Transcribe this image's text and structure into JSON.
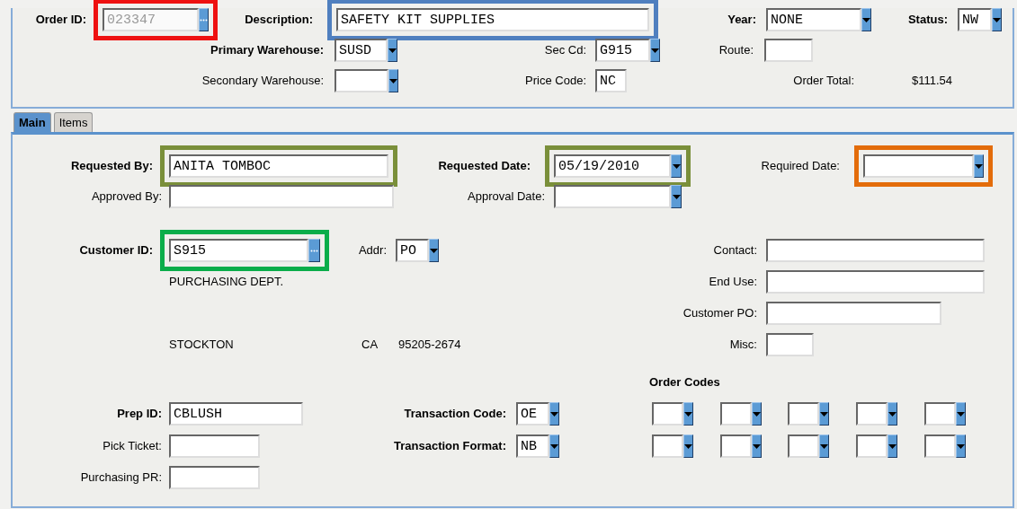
{
  "header": {
    "rows": [
      {
        "fields": [
          {
            "label": "Order ID:",
            "bold": true,
            "control": {
              "kind": "lookup",
              "value": "023347",
              "disabled": true,
              "color": "#ee1111"
            }
          },
          {
            "label": "Description:",
            "bold": true,
            "control": {
              "kind": "input",
              "value": "SAFETY KIT SUPPLIES",
              "color": "#4f7fbf"
            }
          },
          {
            "label": "Year:",
            "bold": true,
            "control": {
              "kind": "select",
              "value": "NONE"
            }
          },
          {
            "label": "Status:",
            "bold": true,
            "control": {
              "kind": "select",
              "value": "NW"
            }
          }
        ]
      },
      {
        "fields": [
          {
            "label": "Primary Warehouse:",
            "bold": true,
            "control": {
              "kind": "select",
              "value": "SUSD"
            }
          },
          {
            "label": "Sec Cd:",
            "control": {
              "kind": "select",
              "value": "G915"
            }
          },
          {
            "label": "Route:",
            "control": {
              "kind": "input"
            }
          }
        ]
      },
      {
        "fields": [
          {
            "label": "Secondary Warehouse:",
            "control": {
              "kind": "select"
            }
          },
          {
            "label": "Price Code:",
            "control": {
              "kind": "input",
              "value": "NC"
            }
          },
          {
            "label": "Order Total:",
            "text": "$111.54"
          }
        ]
      }
    ]
  },
  "tabs": [
    {
      "label": "Main",
      "selected": true
    },
    {
      "label": "Items",
      "selected": false
    }
  ],
  "main": {
    "rows": [
      {
        "fields": [
          {
            "label": "Requested By:",
            "bold": true,
            "control": {
              "kind": "input",
              "value": "ANITA TOMBOC",
              "color": "#7a8f3a"
            }
          },
          {
            "label": "Requested Date:",
            "bold": true,
            "control": {
              "kind": "select",
              "value": "05/19/2010",
              "color": "#7a8f3a"
            }
          },
          {
            "label": "Required Date:",
            "control": {
              "kind": "select",
              "color": "#e36c0a"
            }
          }
        ]
      },
      {
        "fields": [
          {
            "label": "Approved By:",
            "control": {
              "kind": "input"
            }
          },
          {
            "label": "Approval Date:",
            "control": {
              "kind": "select"
            }
          }
        ]
      },
      {
        "fields": [
          {
            "label": "Customer ID:",
            "bold": true,
            "control": {
              "kind": "lookup",
              "value": "S915",
              "color": "#0aad4a"
            }
          },
          {
            "label": "Addr:",
            "control": {
              "kind": "select",
              "value": "PO"
            }
          },
          {
            "label": "Contact:",
            "control": {
              "kind": "input"
            }
          }
        ]
      },
      {
        "fields": [
          {
            "text": "PURCHASING DEPT."
          },
          {
            "label": "End Use:",
            "control": {
              "kind": "input"
            }
          }
        ]
      },
      {
        "fields": [
          {
            "label": "Customer PO:",
            "control": {
              "kind": "input"
            }
          }
        ]
      },
      {
        "fields": [
          {
            "text": "STOCKTON"
          },
          {
            "text": "CA"
          },
          {
            "text": "95205-2674"
          },
          {
            "label": "Misc:",
            "control": {
              "kind": "input"
            }
          }
        ]
      },
      {
        "fields": [
          {
            "heading": "Order Codes"
          }
        ]
      },
      {
        "fields": [
          {
            "label": "Prep ID:",
            "bold": true,
            "control": {
              "kind": "input",
              "value": "CBLUSH"
            }
          },
          {
            "label": "Transaction Code:",
            "bold": true,
            "control": {
              "kind": "select",
              "value": "OE"
            }
          },
          {
            "control": {
              "kind": "select"
            }
          },
          {
            "control": {
              "kind": "select"
            }
          },
          {
            "control": {
              "kind": "select"
            }
          },
          {
            "control": {
              "kind": "select"
            }
          },
          {
            "control": {
              "kind": "select"
            }
          }
        ]
      },
      {
        "fields": [
          {
            "label": "Pick Ticket:",
            "control": {
              "kind": "input"
            }
          },
          {
            "label": "Transaction Format:",
            "bold": true,
            "control": {
              "kind": "select",
              "value": "NB"
            }
          },
          {
            "control": {
              "kind": "select"
            }
          },
          {
            "control": {
              "kind": "select"
            }
          },
          {
            "control": {
              "kind": "select"
            }
          },
          {
            "control": {
              "kind": "select"
            }
          },
          {
            "control": {
              "kind": "select"
            }
          }
        ]
      },
      {
        "fields": [
          {
            "label": "Purchasing PR:",
            "control": {
              "kind": "input"
            }
          }
        ]
      }
    ]
  }
}
